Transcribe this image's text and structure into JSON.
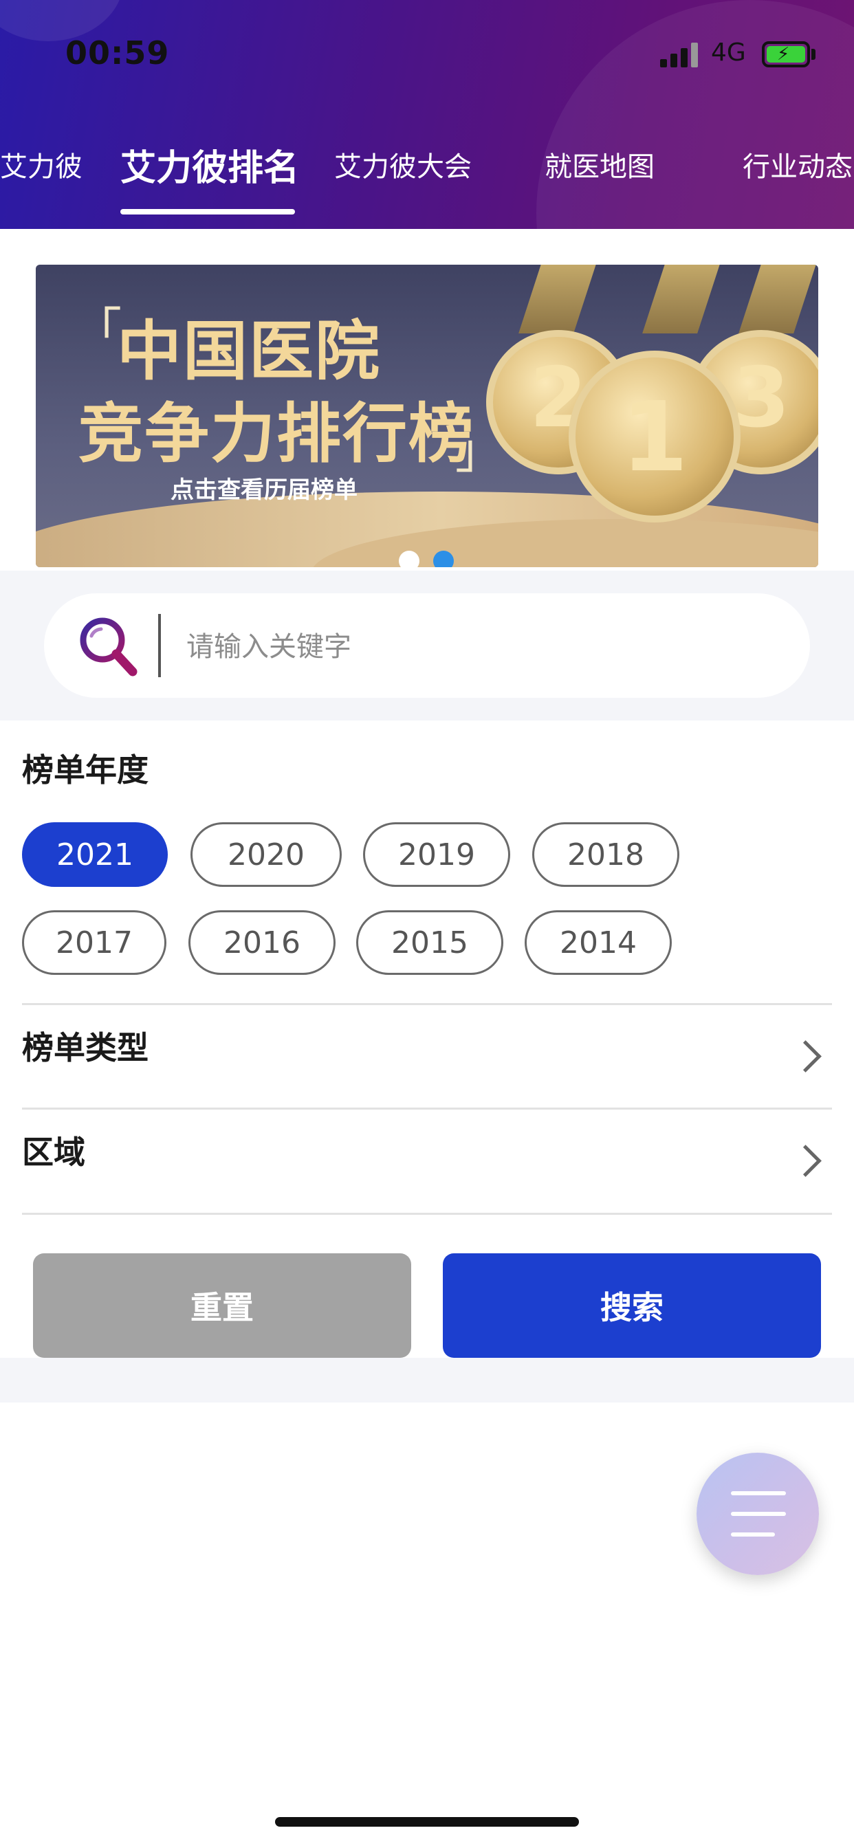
{
  "status": {
    "time": "00:59",
    "network": "4G"
  },
  "tabs": {
    "items": [
      {
        "label": "艾力彼"
      },
      {
        "label": "艾力彼排名"
      },
      {
        "label": "艾力彼大会"
      },
      {
        "label": "就医地图"
      },
      {
        "label": "行业动态"
      }
    ],
    "active_index": 1
  },
  "banner": {
    "title_line1": "中国医院",
    "title_line2": "竞争力排行榜",
    "subtitle": "点击查看历届榜单",
    "medal_labels": [
      "2",
      "1",
      "3"
    ],
    "dot_count": 2,
    "active_dot": 1
  },
  "search": {
    "placeholder": "请输入关键字",
    "value": ""
  },
  "filters": {
    "year_title": "榜单年度",
    "years": [
      "2021",
      "2020",
      "2019",
      "2018",
      "2017",
      "2016",
      "2015",
      "2014"
    ],
    "selected_year": "2021",
    "type_label": "榜单类型",
    "region_label": "区域"
  },
  "actions": {
    "reset_label": "重置",
    "search_label": "搜索"
  },
  "colors": {
    "accent": "#1c3fcf",
    "reset_gray": "#a3a3a3",
    "header_start": "#2a1ba6",
    "header_end": "#6e1472"
  },
  "icons": {
    "search": "search-icon",
    "menu": "menu-icon",
    "chevron": "chevron-right-icon"
  }
}
